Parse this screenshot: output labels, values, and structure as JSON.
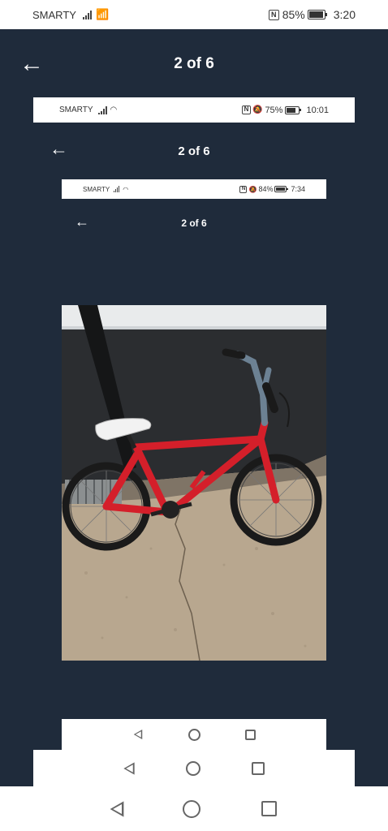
{
  "outer": {
    "status": {
      "carrier": "SMARTY",
      "battery": "85%",
      "time": "3:20"
    },
    "header": {
      "title": "2 of 6"
    }
  },
  "level2": {
    "status": {
      "carrier": "SMARTY",
      "battery": "75%",
      "time": "10:01"
    },
    "header": {
      "title": "2 of 6"
    }
  },
  "level3": {
    "status": {
      "carrier": "SMARTY",
      "battery": "84%",
      "time": "7:34"
    },
    "header": {
      "title": "2 of 6"
    }
  },
  "photo": {
    "subject": "red BMX bike"
  },
  "icons": {
    "back": "arrow-left-icon",
    "nav_back": "triangle-back-icon",
    "nav_home": "circle-home-icon",
    "nav_recents": "square-recents-icon"
  },
  "colors": {
    "panel": "#1f2b3b",
    "bike": "#d41f2a"
  }
}
